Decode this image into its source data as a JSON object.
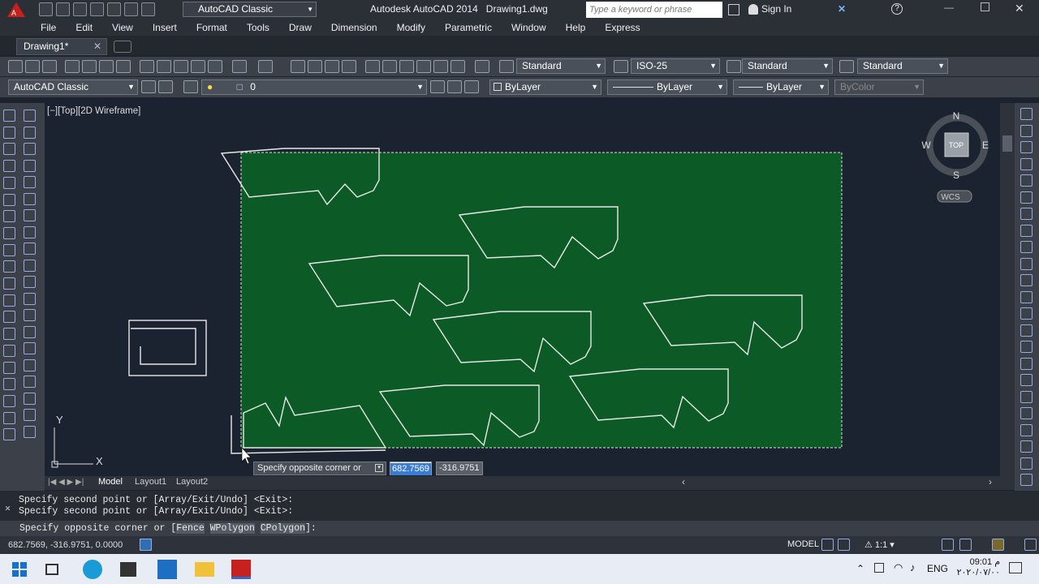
{
  "app": {
    "title": "Autodesk AutoCAD 2014",
    "doc_name": "Drawing1.dwg",
    "workspace": "AutoCAD Classic",
    "search_placeholder": "Type a keyword or phrase",
    "sign_in": "Sign In"
  },
  "menus": [
    "File",
    "Edit",
    "View",
    "Insert",
    "Format",
    "Tools",
    "Draw",
    "Dimension",
    "Modify",
    "Parametric",
    "Window",
    "Help",
    "Express"
  ],
  "doc_tab": "Drawing1*",
  "styles": {
    "text_style": "Standard",
    "dim_style": "ISO-25",
    "table_style": "Standard",
    "mleader_style": "Standard"
  },
  "props": {
    "workspace": "AutoCAD Classic",
    "layer": "0",
    "color": "ByLayer",
    "linetype": "ByLayer",
    "lineweight": "ByLayer",
    "plotstyle": "ByColor"
  },
  "viewport_label": "[−][Top][2D Wireframe]",
  "viewcube": {
    "n": "N",
    "s": "S",
    "e": "E",
    "w": "W",
    "face": "TOP",
    "ucs": "WCS"
  },
  "ucs_icon": {
    "x": "X",
    "y": "Y"
  },
  "tooltip": {
    "prompt": "Specify opposite corner or",
    "x_value": "682.7569",
    "y_value": "-316.9751"
  },
  "layout_tabs": [
    "Model",
    "Layout1",
    "Layout2"
  ],
  "command_history": [
    "Specify second point or [Array/Exit/Undo] <Exit>:",
    "Specify second point or [Array/Exit/Undo] <Exit>:"
  ],
  "command_line": {
    "prefix": "Specify opposite corner or [",
    "opt1": "Fence",
    "opt2": "WPolygon",
    "opt3": "CPolygon",
    "suffix": "]:"
  },
  "status": {
    "coords": "682.7569, -316.9751, 0.0000",
    "model": "MODEL",
    "scale": "1:1"
  },
  "taskbar": {
    "time": "09:01 م",
    "date": "٢٠٢٠/٠٧/٠٠",
    "lang": "ENG"
  },
  "colors": {
    "selection_fill": "#0c5a25",
    "canvas": "#1b2230",
    "accent": "#c8201e"
  }
}
